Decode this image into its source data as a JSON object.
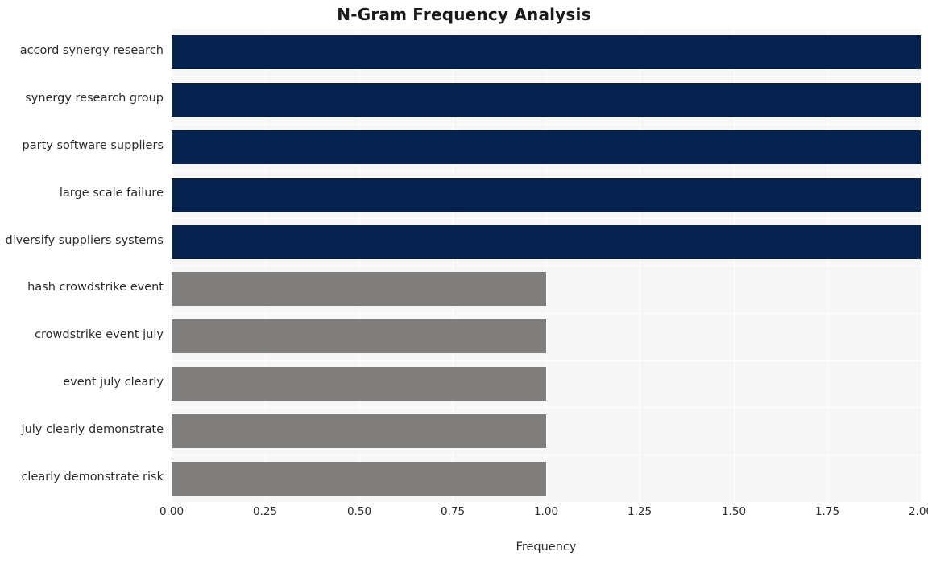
{
  "chart_data": {
    "type": "bar",
    "orientation": "horizontal",
    "title": "N-Gram Frequency Analysis",
    "xlabel": "Frequency",
    "ylabel": "",
    "categories": [
      "accord synergy research",
      "synergy research group",
      "party software suppliers",
      "large scale failure",
      "diversify suppliers systems",
      "hash crowdstrike event",
      "crowdstrike event july",
      "event july clearly",
      "july clearly demonstrate",
      "clearly demonstrate risk"
    ],
    "values": [
      2,
      2,
      2,
      2,
      2,
      1,
      1,
      1,
      1,
      1
    ],
    "bar_colors": [
      "#04224d",
      "#04224d",
      "#04224d",
      "#04224d",
      "#04224d",
      "#807e7c",
      "#807e7c",
      "#807e7c",
      "#807e7c",
      "#807e7c"
    ],
    "xlim": [
      0.0,
      2.0
    ],
    "xticks": [
      0.0,
      0.25,
      0.5,
      0.75,
      1.0,
      1.25,
      1.5,
      1.75,
      2.0
    ],
    "xticklabels": [
      "0.00",
      "0.25",
      "0.50",
      "0.75",
      "1.00",
      "1.25",
      "1.50",
      "1.75",
      "2.00"
    ],
    "grid": true,
    "grid_color": "#ffffff",
    "plot_background": "#f7f7f7",
    "figure_background": "#ffffff",
    "legend": null
  }
}
